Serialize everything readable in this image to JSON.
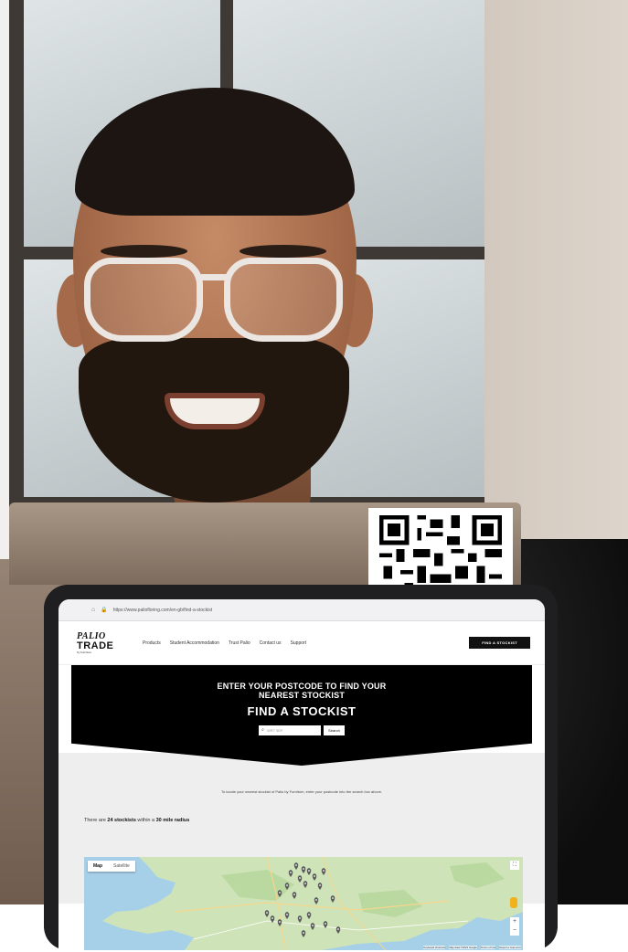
{
  "qr": {
    "icon": "qr-code-icon"
  },
  "browser": {
    "url": "https://www.paliofloring.com/en-gb/find-a-stockist",
    "home_icon": "home-icon",
    "lock_icon": "lock-icon"
  },
  "site": {
    "logo": {
      "line1": "PALIO",
      "line2": "TRADE",
      "line3": "by Furniture"
    },
    "nav": [
      "Products",
      "Student Accommodation",
      "Trust Palio",
      "Contact us",
      "Support"
    ],
    "cta": "FIND A STOCKIST"
  },
  "hero": {
    "line1": "ENTER YOUR POSTCODE TO FIND YOUR",
    "line2": "NEAREST STOCKIST",
    "title": "FIND A STOCKIST",
    "search_placeholder": "WR7 5EF",
    "search_button": "Search"
  },
  "intro": "To locate your nearest stockist of Palio by Furnitom, enter your postcode into the search box above.",
  "results": {
    "prefix": "There are",
    "count": "24 stockists",
    "middle": "within a",
    "radius": "30 mile radius"
  },
  "map": {
    "tabs": [
      "Map",
      "Satellite"
    ],
    "active_tab": "Map",
    "fullscreen_icon": "fullscreen-icon",
    "pegman_icon": "pegman-icon",
    "zoom_in": "+",
    "zoom_out": "−",
    "attribution": [
      "Keyboard shortcuts",
      "Map data ©2023 Google",
      "Terms of Use",
      "Report a map error"
    ],
    "colors": {
      "sea": "#a6cfe8",
      "land": "#cfe3b8",
      "park": "#b9d9a0",
      "pin": "#5a5a5a"
    }
  }
}
